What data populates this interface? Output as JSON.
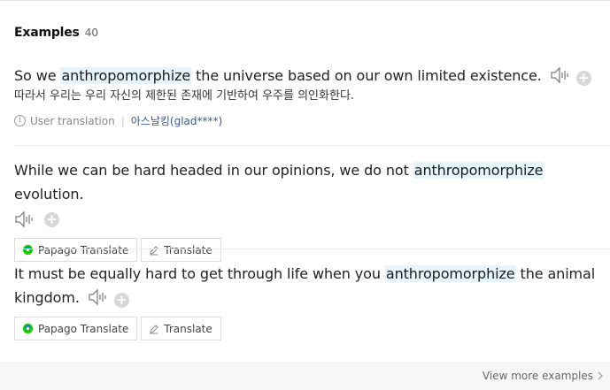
{
  "section": {
    "title": "Examples",
    "count": "40"
  },
  "examples": [
    {
      "before": "So we ",
      "keyword": "anthropomorphize",
      "after": " the universe based on our own limited existence.",
      "translation": "따라서 우리는 우리 자신의 제한된 존재에 기반하여 우주를 의인화한다.",
      "source_label": "User translation",
      "source_user": "아스날킹(glad****)"
    },
    {
      "before": "While we can be hard headed in our opinions, we do not ",
      "keyword": "anthropomorphize",
      "after": " evolution."
    },
    {
      "before": "It must be equally hard to get through life when you ",
      "keyword": "anthropomorphize",
      "after": " the animal kingdom."
    }
  ],
  "buttons": {
    "papago": "Papago Translate",
    "translate": "Translate"
  },
  "footer": {
    "view_more": "View more examples"
  },
  "colors": {
    "highlight": "#e6f4fb",
    "papago_green": "#1ec800",
    "papago_blue": "#0f7fd7"
  },
  "icons": [
    "speaker-icon",
    "plus-icon",
    "info-icon",
    "papago-icon",
    "pencil-icon",
    "chevron-right-icon"
  ]
}
